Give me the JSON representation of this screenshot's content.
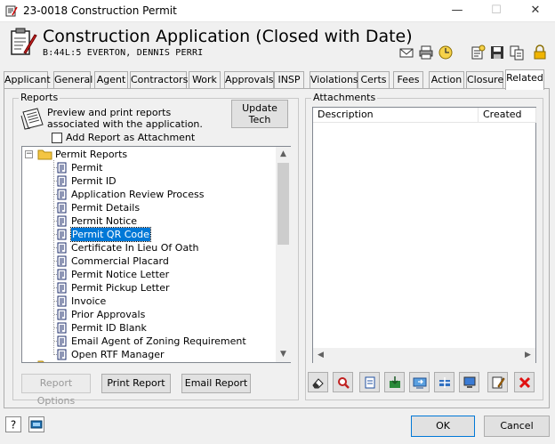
{
  "window": {
    "title": "23-0018 Construction Permit",
    "min_glyph": "—",
    "max_glyph": "☐",
    "close_glyph": "✕"
  },
  "header": {
    "heading": "Construction Application (Closed with Date)",
    "subheading": "B:44L:5 EVERTON, DENNIS PERRI",
    "tool_icons": [
      "mail-icon",
      "print-icon",
      "clock-icon",
      "notes-icon",
      "save-icon",
      "copy-icon",
      "lock-icon"
    ]
  },
  "tabs": [
    {
      "label": "Applicant"
    },
    {
      "label": "General"
    },
    {
      "label": "Agent"
    },
    {
      "label": "Contractors"
    },
    {
      "label": "Work"
    },
    {
      "label": "Approvals"
    },
    {
      "label": "INSP"
    },
    {
      "label": "Violations"
    },
    {
      "label": "Certs"
    },
    {
      "label": "Fees"
    },
    {
      "label": "Action"
    },
    {
      "label": "Closure"
    },
    {
      "label": "Related",
      "active": true
    }
  ],
  "reports": {
    "group_label": "Reports",
    "description": "Preview and print reports associated with the application.",
    "update_button": "Update Tech",
    "attach_checkbox_label": "Add Report as Attachment",
    "attach_checked": false,
    "folder": "Permit Reports",
    "items": [
      "Permit",
      "Permit ID",
      "Application Review Process",
      "Permit Details",
      "Permit Notice",
      "Permit QR Code",
      "Certificate In Lieu Of Oath",
      "Commercial Placard",
      "Permit Notice Letter",
      "Permit Pickup Letter",
      "Invoice",
      "Prior Approvals",
      "Permit ID Blank",
      "Email Agent of Zoning Requirement",
      "Open RTF Manager"
    ],
    "selected": "Permit QR Code",
    "buttons": {
      "options": "Report Options",
      "print": "Print Report",
      "email": "Email Report"
    }
  },
  "attachments": {
    "group_label": "Attachments",
    "columns": [
      "Description",
      "Created"
    ],
    "rows": [],
    "toolbar_icons": [
      "eraser-icon",
      "find-icon",
      "view-icon",
      "save-icon",
      "import-icon",
      "scan-icon",
      "monitor-icon",
      "edit-icon",
      "delete-icon"
    ]
  },
  "footer": {
    "help_icon": "help-icon",
    "keyboard_icon": "keyboard-icon",
    "ok": "OK",
    "cancel": "Cancel"
  },
  "colors": {
    "selection": "#0078d7",
    "folder": "#f4c542",
    "delete": "#e01010"
  }
}
